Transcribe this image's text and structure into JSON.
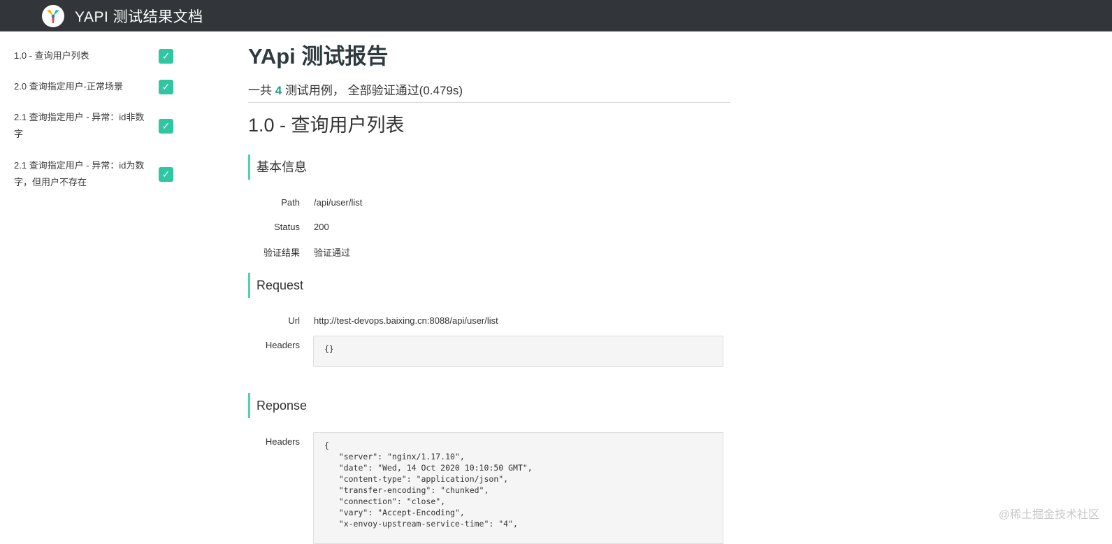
{
  "app": {
    "title": "YAPI 测试结果文档"
  },
  "sidebar": {
    "items": [
      {
        "label": "1.0 - 查询用户列表",
        "status": "pass"
      },
      {
        "label": "2.0 查询指定用户-正常场景",
        "status": "pass"
      },
      {
        "label": "2.1 查询指定用户 - 异常：id非数字",
        "status": "pass"
      },
      {
        "label": "2.1 查询指定用户 - 异常：id为数字，但用户不存在",
        "status": "pass"
      }
    ],
    "check_glyph": "✓"
  },
  "report": {
    "title": "YApi 测试报告",
    "summary_prefix": "一共",
    "total": "4",
    "summary_mid": "测试用例，",
    "summary_suffix": "全部验证通过(0.479s)"
  },
  "case": {
    "title": "1.0 - 查询用户列表",
    "basic": {
      "heading": "基本信息",
      "path_label": "Path",
      "path": "/api/user/list",
      "status_label": "Status",
      "status": "200",
      "result_label": "验证结果",
      "result": "验证通过"
    },
    "request": {
      "heading": "Request",
      "url_label": "Url",
      "url": "http://test-devops.baixing.cn:8088/api/user/list",
      "headers_label": "Headers",
      "headers": "{}"
    },
    "response": {
      "heading": "Reponse",
      "headers_label": "Headers",
      "headers": "{\n   \"server\": \"nginx/1.17.10\",\n   \"date\": \"Wed, 14 Oct 2020 10:10:50 GMT\",\n   \"content-type\": \"application/json\",\n   \"transfer-encoding\": \"chunked\",\n   \"connection\": \"close\",\n   \"vary\": \"Accept-Encoding\",\n   \"x-envoy-upstream-service-time\": \"4\","
    }
  },
  "watermark": "@稀土掘金技术社区",
  "colors": {
    "topbar": "#32363a",
    "accent": "#2fc6a1",
    "section_bar": "#55d0ae"
  }
}
